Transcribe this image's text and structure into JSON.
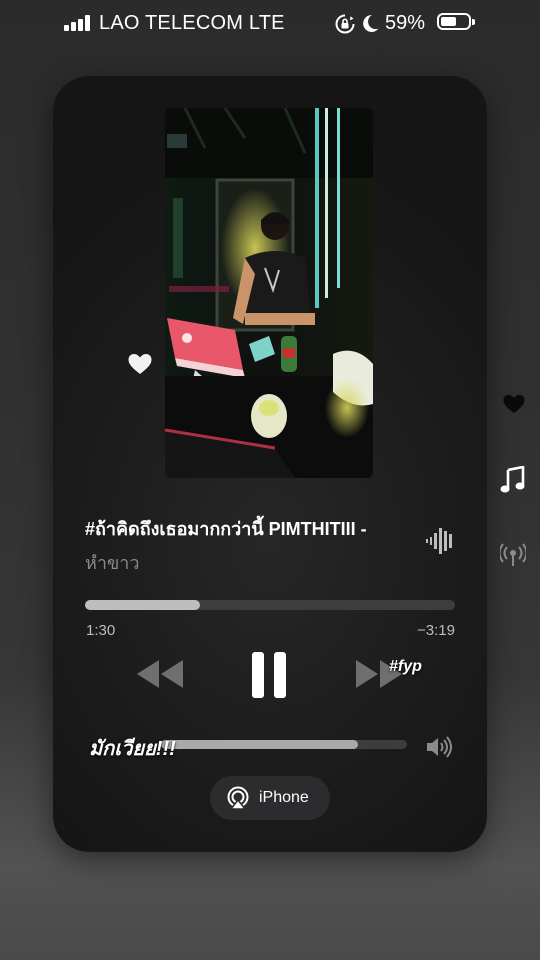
{
  "status_bar": {
    "carrier": "LAO TELECOM LTE",
    "battery_percent": "59%",
    "battery_level": 0.59,
    "icons": [
      "signal-bars-icon",
      "orientation-lock-icon",
      "do-not-disturb-moon-icon",
      "battery-icon"
    ]
  },
  "now_playing": {
    "artwork_icon": "video-artwork-dj-booth",
    "favorite_icon": "heart-icon",
    "title": "#ถ้าคิดถึงเธอมากกว่านี้  PIMTHITIII -",
    "artist": "หำขาว",
    "waveform_icon": "audio-waveform-icon",
    "progress": 0.31,
    "elapsed": "1:30",
    "remaining": "−3:19",
    "overlay_tag": "#fyp",
    "volume_caption": "มักเวียย!!!",
    "volume_level": 0.8,
    "speaker_icon": "speaker-volume-icon",
    "airplay": {
      "icon": "airplay-icon",
      "label": "iPhone"
    }
  },
  "controls": {
    "previous_icon": "rewind-icon",
    "play_pause_icon": "pause-icon",
    "next_icon": "fast-forward-icon"
  },
  "side_icons": [
    "heart-icon",
    "music-note-icon",
    "broadcast-icon"
  ],
  "colors": {
    "background": "#2b2b2c",
    "card": "#1b1b1b",
    "text_secondary": "#8a8a8c",
    "track": "#3d3d3f",
    "progress_fill": "#bebec0"
  }
}
